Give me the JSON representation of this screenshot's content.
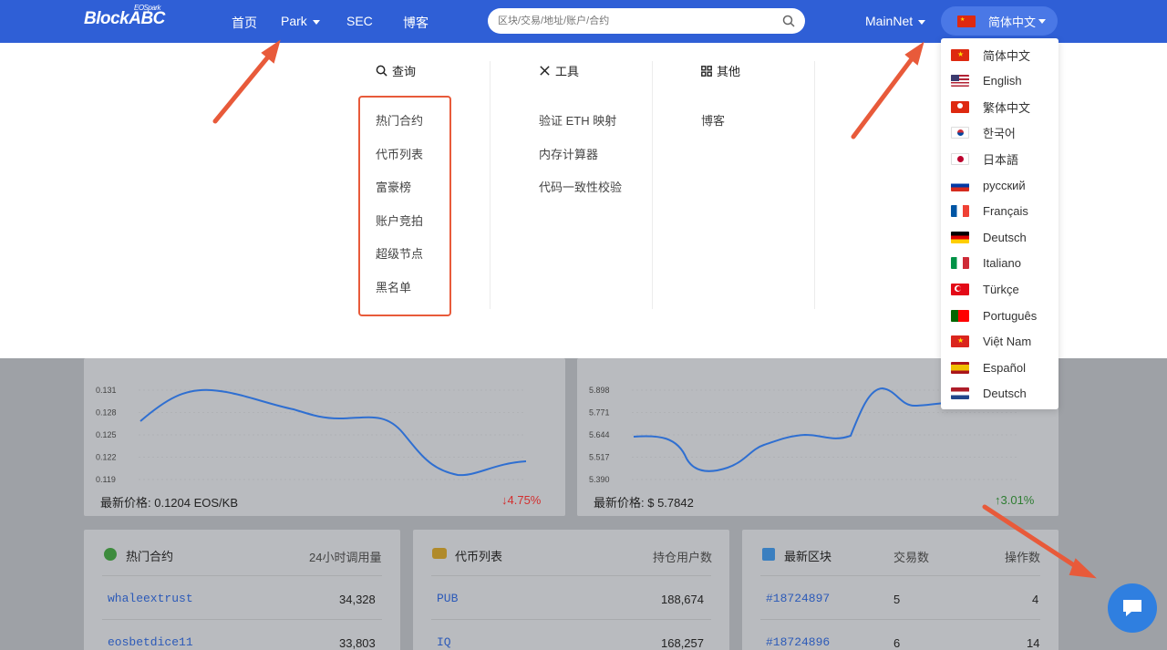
{
  "header": {
    "logo": "BlockABC",
    "logo_sup": "EOSpark",
    "nav": [
      "首页",
      "Park",
      "SEC",
      "博客"
    ],
    "search_placeholder": "区块/交易/地址/账户/合约",
    "network": "MainNet",
    "language": "简体中文"
  },
  "mega_menu": {
    "columns": [
      {
        "title": "查询",
        "icon": "search-icon",
        "items": [
          "热门合约",
          "代币列表",
          "富豪榜",
          "账户竞拍",
          "超级节点",
          "黑名单"
        ]
      },
      {
        "title": "工具",
        "icon": "tools-icon",
        "items": [
          "验证 ETH 映射",
          "内存计算器",
          "代码一致性校验"
        ]
      },
      {
        "title": "其他",
        "icon": "grid-icon",
        "items": [
          "博客"
        ]
      }
    ]
  },
  "languages": [
    "简体中文",
    "English",
    "繁体中文",
    "한국어",
    "日本語",
    "русский",
    "Français",
    "Deutsch",
    "Italiano",
    "Türkçe",
    "Português",
    "Việt Nam",
    "Español",
    "Deutsch"
  ],
  "ram_chart": {
    "yticks": [
      "0.131",
      "0.128",
      "0.125",
      "0.122",
      "0.119"
    ],
    "latest_label": "最新价格: 0.1204 EOS/KB",
    "change": "↓4.75%"
  },
  "eos_chart": {
    "yticks": [
      "5.898",
      "5.771",
      "5.644",
      "5.517",
      "5.390"
    ],
    "latest_label": "最新价格: $ 5.7842",
    "change": "↑3.01%"
  },
  "hot_contracts": {
    "title": "热门合约",
    "col": "24小时调用量",
    "rows": [
      {
        "name": "whaleextrust",
        "value": "34,328"
      },
      {
        "name": "eosbetdice11",
        "value": "33,803"
      }
    ]
  },
  "token_list": {
    "title": "代币列表",
    "col": "持仓用户数",
    "rows": [
      {
        "name": "PUB",
        "value": "188,674"
      },
      {
        "name": "IQ",
        "value": "168,257"
      }
    ]
  },
  "latest_blocks": {
    "title": "最新区块",
    "col1": "交易数",
    "col2": "操作数",
    "rows": [
      {
        "block": "#18724897",
        "tx": "5",
        "ops": "4"
      },
      {
        "block": "#18724896",
        "tx": "6",
        "ops": "14"
      }
    ]
  },
  "colors": {
    "header": "#2f5fd6",
    "accent_arrow": "#e85a3a",
    "link": "#2c5ab8",
    "down": "#e53935",
    "up": "#43a047"
  }
}
